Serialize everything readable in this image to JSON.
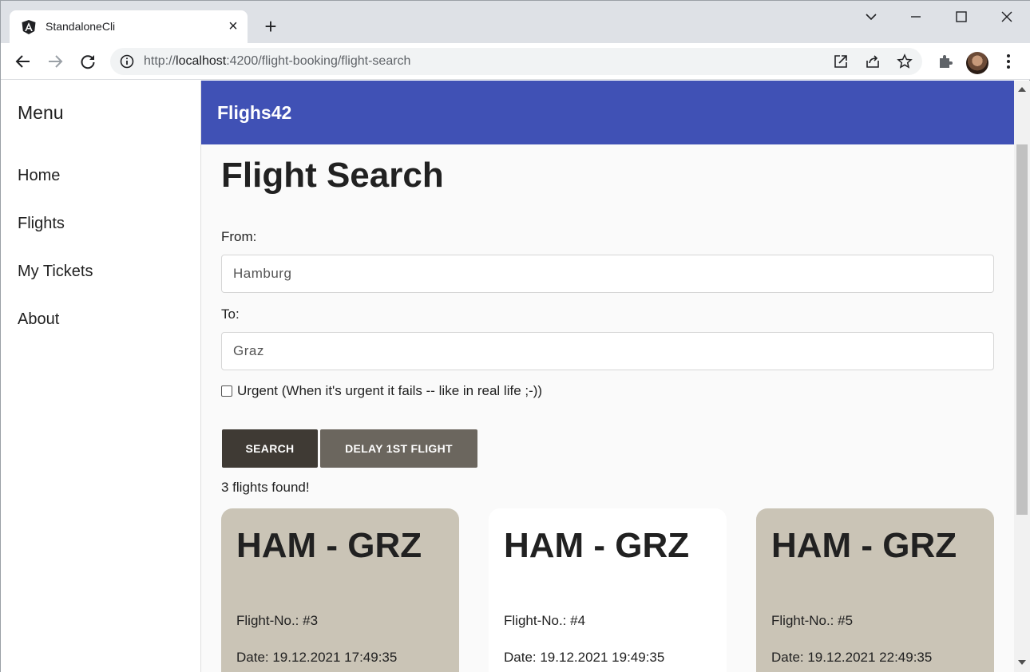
{
  "browser": {
    "tab_title": "StandaloneCli",
    "url_scheme": "http://",
    "url_host": "localhost",
    "url_path": ":4200/flight-booking/flight-search"
  },
  "app": {
    "title": "Flighs42"
  },
  "sidebar": {
    "title": "Menu",
    "items": [
      {
        "label": "Home"
      },
      {
        "label": "Flights"
      },
      {
        "label": "My Tickets"
      },
      {
        "label": "About"
      }
    ]
  },
  "search": {
    "page_title": "Flight Search",
    "from_label": "From:",
    "from_value": "Hamburg",
    "to_label": "To:",
    "to_value": "Graz",
    "urgent_label": "Urgent (When it's urgent it fails -- like in real life ;-))",
    "urgent_checked": false,
    "search_button": "SEARCH",
    "delay_button": "DELAY 1ST FLIGHT",
    "result_count": "3 flights found!"
  },
  "flights": [
    {
      "route": "HAM - GRZ",
      "number": "Flight-No.: #3",
      "date": "Date: 19.12.2021 17:49:35",
      "selected": true
    },
    {
      "route": "HAM - GRZ",
      "number": "Flight-No.: #4",
      "date": "Date: 19.12.2021 19:49:35",
      "selected": false
    },
    {
      "route": "HAM - GRZ",
      "number": "Flight-No.: #5",
      "date": "Date: 19.12.2021 22:49:35",
      "selected": true
    }
  ],
  "colors": {
    "appbar": "#4051b5",
    "card_selected": "#cac4b6",
    "card_plain": "#ffffff",
    "button_primary": "#3f3a34",
    "button_secondary": "#6b665e"
  }
}
